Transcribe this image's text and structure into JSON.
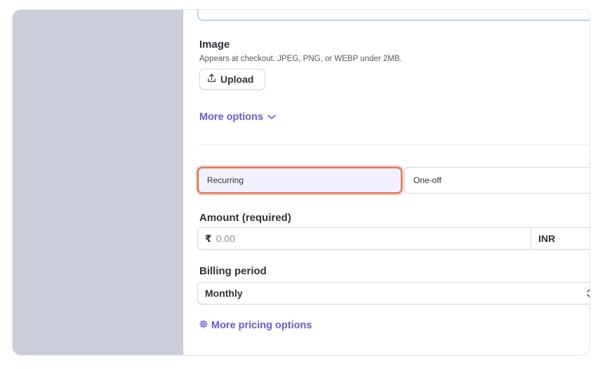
{
  "image_section": {
    "title": "Image",
    "hint": "Appears at checkout. JPEG, PNG, or WEBP under 2MB.",
    "upload_label": "Upload"
  },
  "more_options_label": "More options",
  "price_type": {
    "options": [
      "Recurring",
      "One-off"
    ],
    "selected": "Recurring"
  },
  "amount": {
    "label": "Amount (required)",
    "currency_symbol": "₹",
    "placeholder": "0.00",
    "currency": "INR"
  },
  "billing_period": {
    "label": "Billing period",
    "value": "Monthly"
  },
  "more_pricing_label": "More pricing options",
  "colors": {
    "accent": "#635bff",
    "focus_ring": "#ed6f4b",
    "selected_bg": "#f3f1ff"
  }
}
